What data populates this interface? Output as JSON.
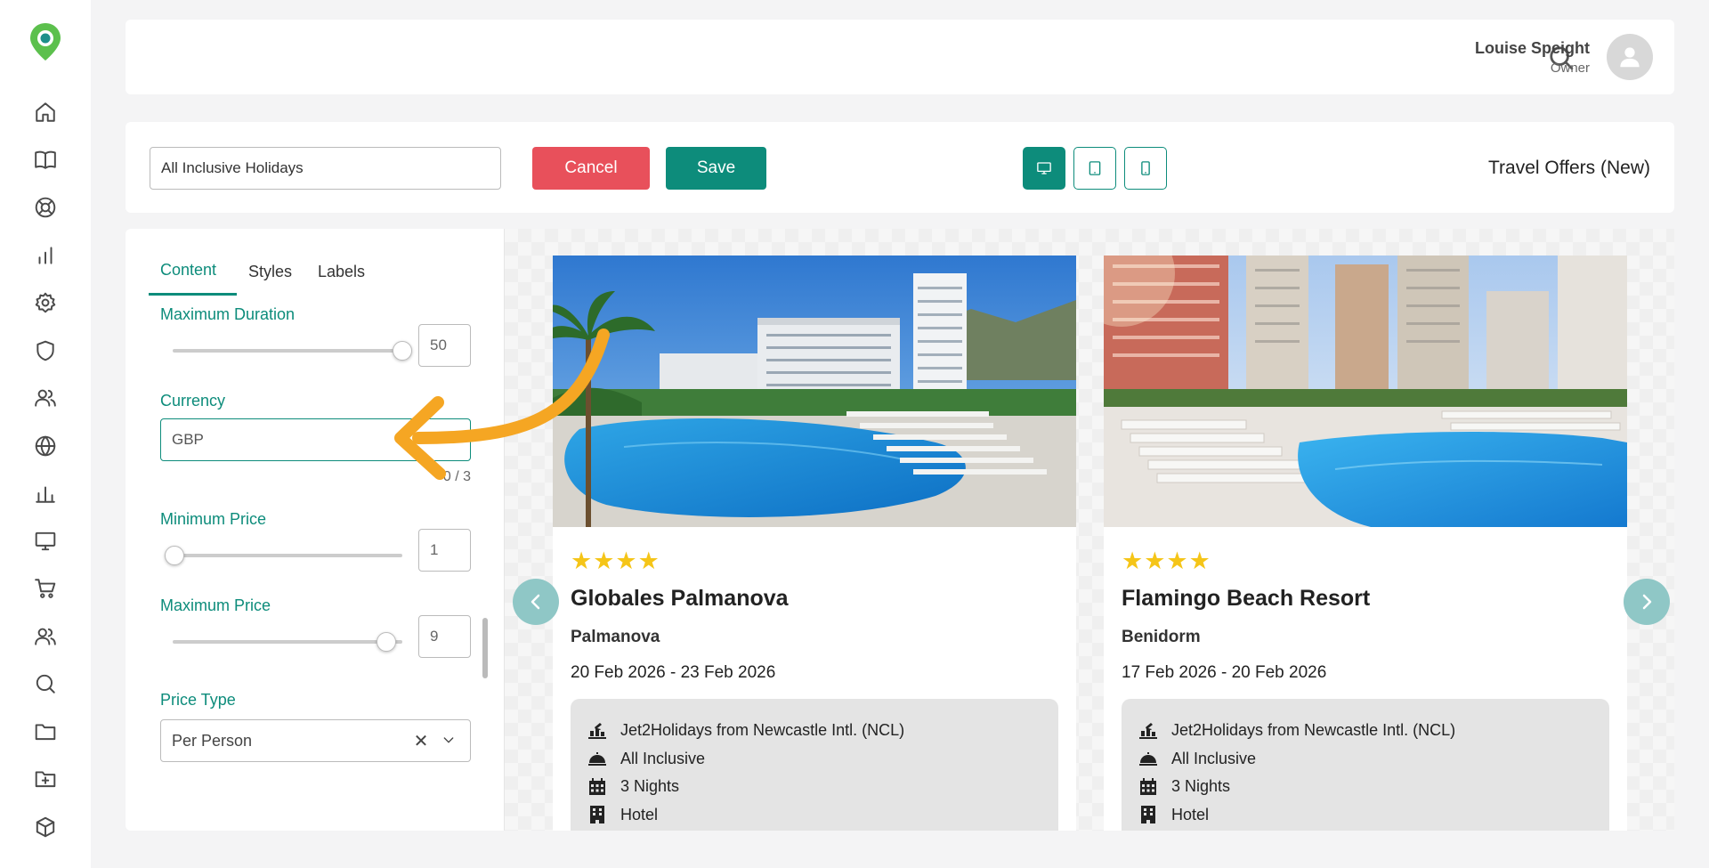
{
  "user": {
    "name": "Louise Speight",
    "role": "Owner"
  },
  "toolbar": {
    "offer_name_value": "All Inclusive Holidays",
    "cancel_label": "Cancel",
    "save_label": "Save",
    "page_title": "Travel Offers (New)",
    "active_device": "desktop"
  },
  "colors": {
    "accent": "#0d8c7b",
    "danger": "#e8505b",
    "star": "#f5c518",
    "arrow_annotation": "#f5a623"
  },
  "sidebar": {
    "icons": [
      "logo-pin-icon",
      "home-icon",
      "book-icon",
      "lifebuoy-icon",
      "bar-chart-icon",
      "gear-icon",
      "shield-icon",
      "users-icon",
      "globe-icon",
      "analytics-icon",
      "monitor-icon",
      "cart-icon",
      "team-icon",
      "search-icon",
      "folder-icon",
      "folder-plus-icon",
      "cube-icon"
    ]
  },
  "editor": {
    "tabs": [
      "Content",
      "Styles",
      "Labels"
    ],
    "active_tab": "Content",
    "max_duration": {
      "label": "Maximum Duration",
      "value": "50",
      "slider_fraction": 1.0
    },
    "currency": {
      "label": "Currency",
      "value": "GBP",
      "counter": "0 / 3"
    },
    "min_price": {
      "label": "Minimum Price",
      "value": "1",
      "slider_fraction": 0.0
    },
    "max_price": {
      "label": "Maximum Price",
      "value": "9",
      "slider_fraction": 0.95
    },
    "price_type": {
      "label": "Price Type",
      "value": "Per Person"
    }
  },
  "offers": [
    {
      "stars": "★★★★",
      "name": "Globales Palmanova",
      "location": "Palmanova",
      "dates": "20 Feb 2026 - 23 Feb 2026",
      "details": {
        "flight": "Jet2Holidays from Newcastle Intl. (NCL)",
        "board": "All Inclusive",
        "nights": "3 Nights",
        "accommodation": "Hotel"
      }
    },
    {
      "stars": "★★★★",
      "name": "Flamingo Beach Resort",
      "location": "Benidorm",
      "dates": "17 Feb 2026 - 20 Feb 2026",
      "details": {
        "flight": "Jet2Holidays from Newcastle Intl. (NCL)",
        "board": "All Inclusive",
        "nights": "3 Nights",
        "accommodation": "Hotel"
      }
    }
  ]
}
